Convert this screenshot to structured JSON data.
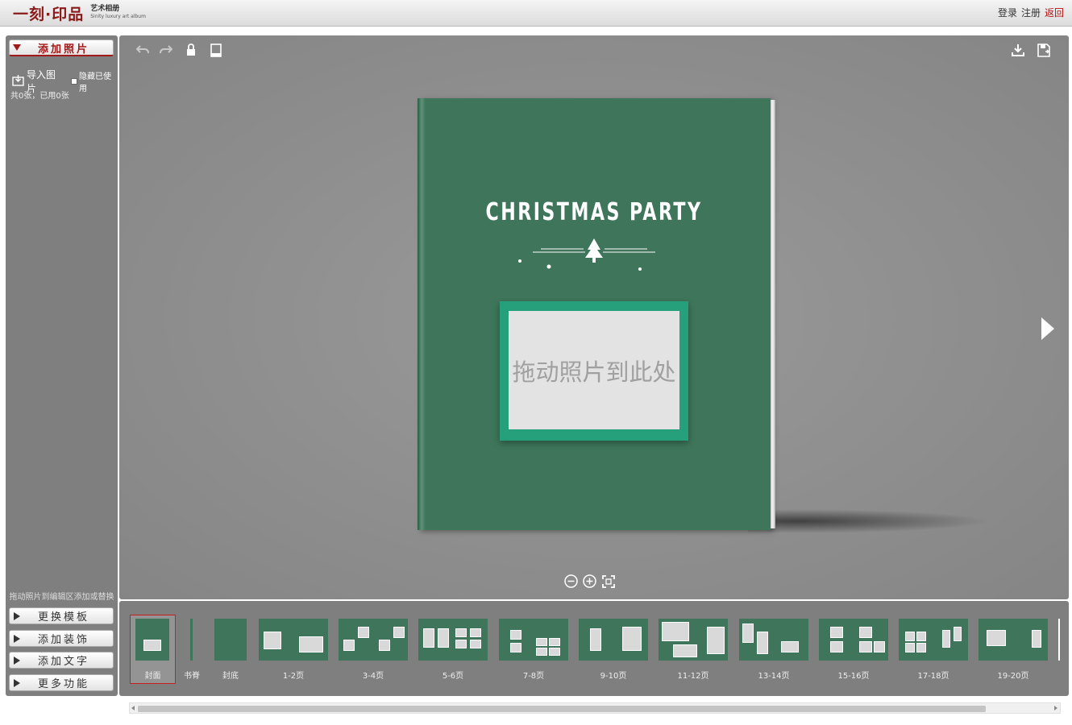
{
  "header": {
    "logo_main": "一刻·印品",
    "logo_sub_cn": "艺术相册",
    "logo_sub_en": "Sinity luxury art album",
    "links": [
      "登录",
      "注册",
      "返回"
    ]
  },
  "sidebar": {
    "add_photo_label": "添加照片",
    "import_label": "导入图片",
    "hide_used_label": "隐藏已使用",
    "count_text": "共0张，已用0张",
    "drag_hint": "拖动照片到编辑区添加或替换",
    "buttons": [
      "更换模板",
      "添加装饰",
      "添加文字",
      "更多功能"
    ]
  },
  "toolbar": {
    "icons": [
      "undo-icon",
      "redo-icon",
      "lock-icon",
      "book-icon"
    ],
    "right_icons": [
      "download-icon",
      "save-icon"
    ]
  },
  "cover": {
    "title": "CHRISTMAS PARTY",
    "placeholder": "拖动照片到此处",
    "cover_color": "#3f765b",
    "frame_color": "#26a07a"
  },
  "zoom": {
    "icons": [
      "zoom-out-icon",
      "zoom-in-icon",
      "fit-icon"
    ]
  },
  "pages": {
    "items": [
      "封面",
      "书脊",
      "封底",
      "1-2页",
      "3-4页",
      "5-6页",
      "7-8页",
      "9-10页",
      "11-12页",
      "13-14页",
      "15-16页",
      "17-18页",
      "19-20页"
    ],
    "selected": "封面"
  }
}
